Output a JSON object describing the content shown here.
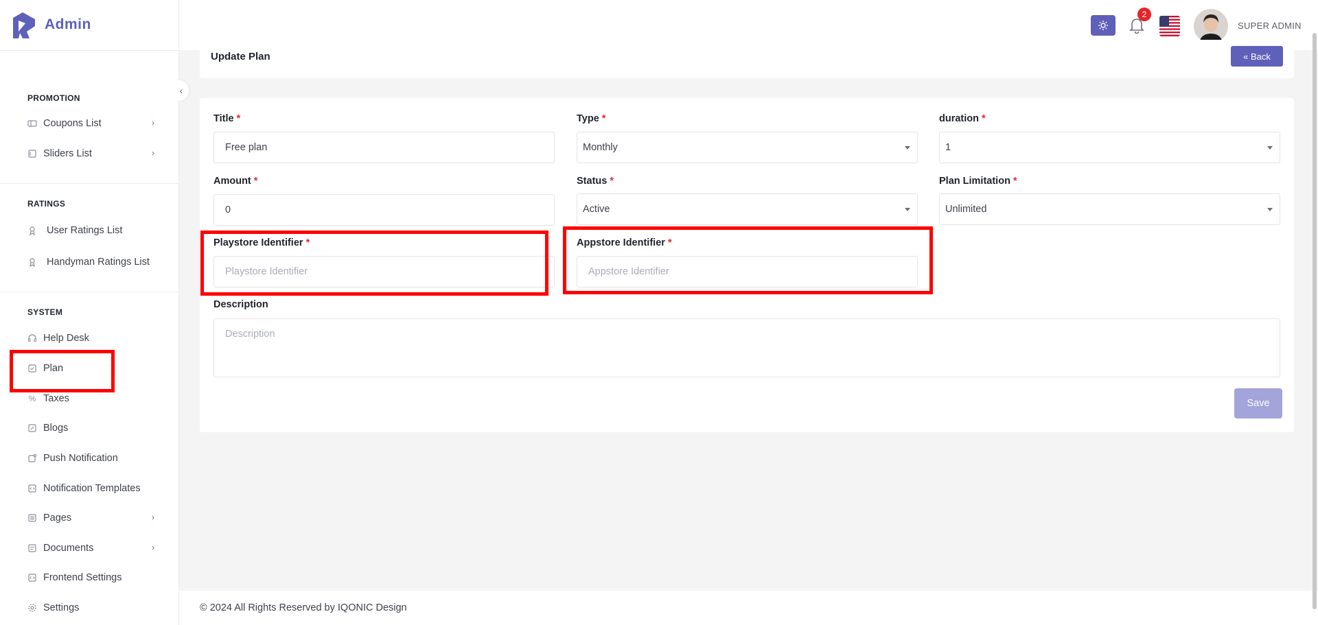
{
  "brand": {
    "name": "Admin"
  },
  "sidebar": {
    "promotion": {
      "title": "PROMOTION",
      "items": [
        {
          "label": "Coupons List",
          "icon": "ticket-icon",
          "has_submenu": true
        },
        {
          "label": "Sliders List",
          "icon": "slides-icon",
          "has_submenu": true
        }
      ]
    },
    "ratings": {
      "title": "RATINGS",
      "items": [
        {
          "label": "User Ratings List",
          "icon": "award-icon"
        },
        {
          "label": "Handyman Ratings List",
          "icon": "award-icon"
        }
      ]
    },
    "system": {
      "title": "SYSTEM",
      "items": [
        {
          "label": "Help Desk",
          "icon": "headset-icon"
        },
        {
          "label": "Plan",
          "icon": "plan-icon",
          "active": true
        },
        {
          "label": "Taxes",
          "icon": "percent-icon"
        },
        {
          "label": "Blogs",
          "icon": "blog-icon"
        },
        {
          "label": "Push Notification",
          "icon": "push-notification-icon"
        },
        {
          "label": "Notification Templates",
          "icon": "code-template-icon"
        },
        {
          "label": "Pages",
          "icon": "pages-icon",
          "has_submenu": true
        },
        {
          "label": "Documents",
          "icon": "documents-icon",
          "has_submenu": true
        },
        {
          "label": "Frontend Settings",
          "icon": "code-template-icon"
        },
        {
          "label": "Settings",
          "icon": "gear-icon"
        }
      ]
    }
  },
  "topbar": {
    "notification_count": "2",
    "user_name": "SUPER ADMIN",
    "theme_icon": "sun-icon",
    "language_flag": "us-flag-icon"
  },
  "header": {
    "title": "Update Plan",
    "back_label": "« Back"
  },
  "form": {
    "title": {
      "label": "Title",
      "required": "*",
      "value": "Free plan"
    },
    "type": {
      "label": "Type",
      "required": "*",
      "value": "Monthly"
    },
    "duration": {
      "label": "duration",
      "required": "*",
      "value": "1"
    },
    "amount": {
      "label": "Amount",
      "required": "*",
      "value": "0"
    },
    "status": {
      "label": "Status",
      "required": "*",
      "value": "Active"
    },
    "plan_limitation": {
      "label": "Plan Limitation",
      "required": "*",
      "value": "Unlimited"
    },
    "playstore_identifier": {
      "label": "Playstore Identifier",
      "required": "*",
      "placeholder": "Playstore Identifier"
    },
    "appstore_identifier": {
      "label": "Appstore Identifier",
      "required": "*",
      "placeholder": "Appstore Identifier"
    },
    "description": {
      "label": "Description",
      "placeholder": "Description"
    },
    "save_label": "Save"
  },
  "footer": {
    "text": "© 2024 All Rights Reserved by IQONIC Design"
  },
  "colors": {
    "accent": "#5f60b9",
    "accent_disabled": "#a3a4d9",
    "required": "#e5252a",
    "highlight": "#ff0000"
  }
}
